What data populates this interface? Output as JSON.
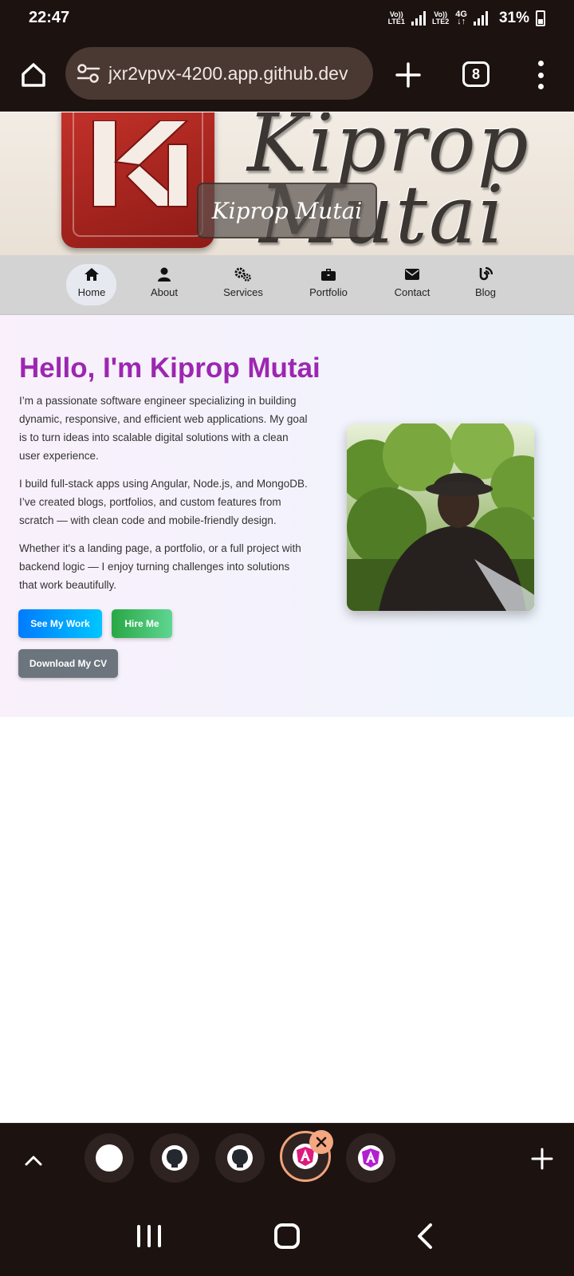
{
  "status_bar": {
    "time": "22:47",
    "sim1_label_top": "Vo))",
    "sim1_label_bottom": "LTE1",
    "sim2_label_top": "Vo))",
    "sim2_label_bottom": "LTE2",
    "network_type": "4G",
    "battery_percent": "31%",
    "battery_level": 0.31
  },
  "browser": {
    "url": "jxr2vpvx-4200.app.github.dev",
    "tab_count": "8",
    "icons": [
      "home-icon",
      "tune-icon",
      "plus-icon",
      "tabs-icon",
      "more-vert-icon"
    ]
  },
  "banner": {
    "script_line_1": "Kiprop",
    "script_line_2": "Mutai",
    "overlay_name": "Kiprop Mutai"
  },
  "nav": {
    "items": [
      {
        "label": "Home",
        "icon": "home-icon",
        "active": true
      },
      {
        "label": "About",
        "icon": "user-icon",
        "active": false
      },
      {
        "label": "Services",
        "icon": "gears-icon",
        "active": false
      },
      {
        "label": "Portfolio",
        "icon": "briefcase-icon",
        "active": false
      },
      {
        "label": "Contact",
        "icon": "envelope-icon",
        "active": false
      },
      {
        "label": "Blog",
        "icon": "blog-icon",
        "active": false
      }
    ]
  },
  "hero": {
    "title": "Hello, I'm Kiprop Mutai",
    "paragraphs": [
      "I’m a passionate software engineer specializing in building dynamic, responsive, and efficient web applications. My goal is to turn ideas into scalable digital solutions with a clean user experience.",
      "I build full-stack apps using Angular, Node.js, and MongoDB. I’ve created blogs, portfolios, and custom features from scratch — with clean code and mobile-friendly design.",
      "Whether it's a landing page, a portfolio, or a full project with backend logic — I enjoy turning challenges into solutions that work beautifully."
    ],
    "buttons": {
      "see_work": "See My Work",
      "hire_me": "Hire Me",
      "download_cv": "Download My CV"
    }
  },
  "tab_strip": {
    "tabs": [
      "blank-tab-icon",
      "github-icon",
      "github-icon",
      "angular-icon",
      "angular-icon"
    ],
    "active_index": 3
  },
  "colors": {
    "title_purple": "#9c27b0",
    "browser_chrome": "#1c1210",
    "url_pill": "#4a3832",
    "active_tab_ring": "#f0a37a"
  }
}
